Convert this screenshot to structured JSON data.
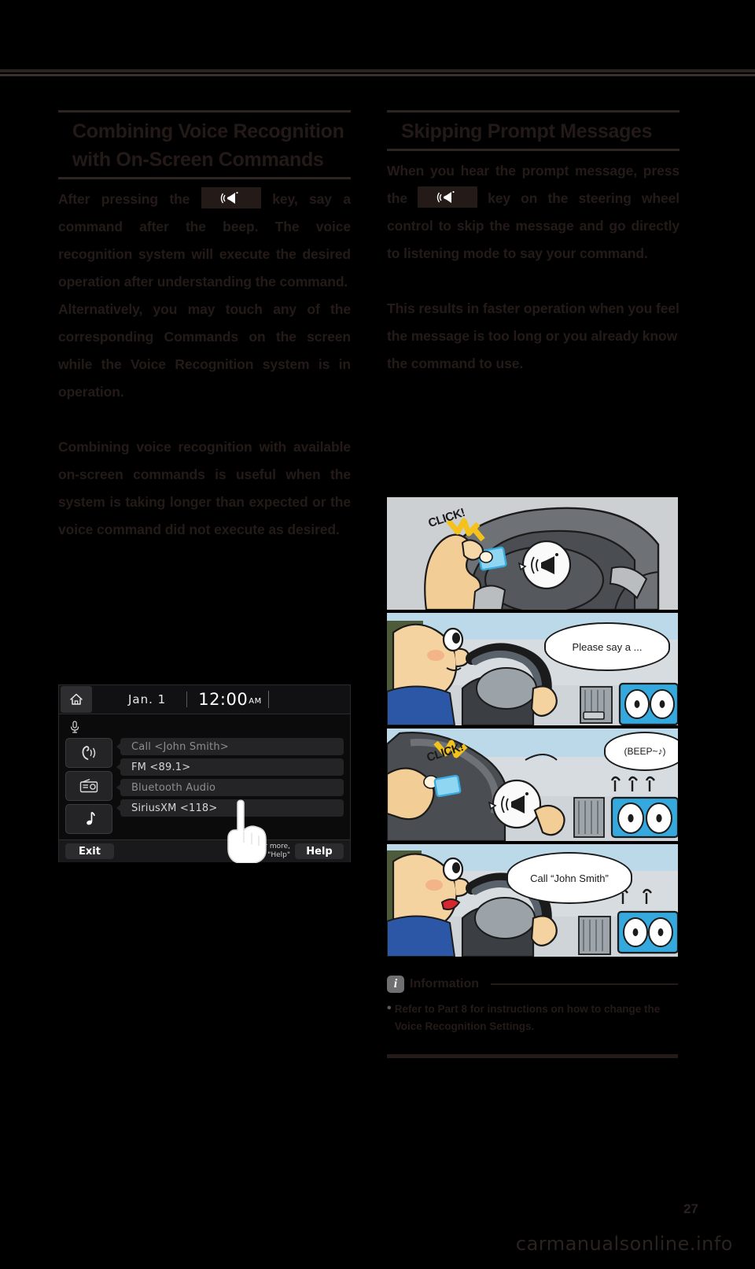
{
  "left_column": {
    "heading": "Combining Voice Recognition with On-Screen Commands",
    "paragraph1_before_key": "After pressing the",
    "paragraph1_after_key": "key, say a command after the beep. The voice recognition system will execute the desired operation after understanding the command.",
    "paragraph2": "Alternatively, you may touch any of the corresponding Commands on the screen while the Voice Recognition system is in operation.",
    "paragraph3": "Combining voice recognition with available on-screen commands is useful when the system is taking longer than expected or the voice command did not execute as desired."
  },
  "right_column": {
    "heading": "Skipping Prompt Messages",
    "paragraph1_before_key": "When you hear the prompt message, press the",
    "paragraph1_after_key": "key on the steering wheel control to skip the message and go directly to listening mode to say your command.",
    "paragraph2": "This results in faster operation when you feel the message is too long or you already know the command to use."
  },
  "screen": {
    "home_icon": "home-icon",
    "date": "Jan. 1",
    "time": "12:00",
    "ampm": "AM",
    "mic_icon": "microphone-icon",
    "tiles": [
      {
        "icon": "phone-call-icon"
      },
      {
        "icon": "radio-icon"
      },
      {
        "icon": "music-note-icon"
      }
    ],
    "commands": [
      {
        "label": "Call <John Smith>",
        "dim": true
      },
      {
        "label": "FM <89.1>",
        "dim": false
      },
      {
        "label": "Bluetooth Audio",
        "dim": true
      },
      {
        "label": "SiriusXM <118>",
        "dim": false
      }
    ],
    "exit_label": "Exit",
    "help_label": "Help",
    "hint_line1": "For more,",
    "hint_line2": "say \"Help\"",
    "hand_icon": "pointing-hand-cursor"
  },
  "comic": {
    "panels": [
      {
        "name": "panel-click-steering-wheel",
        "sound": "CLICK!",
        "bubble": "",
        "bubble_icon": "voice-recognition-icon"
      },
      {
        "name": "panel-please-say-a",
        "sound": "",
        "bubble": "Please say a ...",
        "bubble_icon": ""
      },
      {
        "name": "panel-click-beep",
        "sound": "CLICK!",
        "bubble": "(BEEP~♪)",
        "bubble_icon": "voice-recognition-icon"
      },
      {
        "name": "panel-call-john-smith",
        "sound": "",
        "bubble": "Call “John Smith”",
        "bubble_icon": ""
      }
    ]
  },
  "information": {
    "icon": "info-icon",
    "title": "Information",
    "bullet": "•",
    "text": "Refer to Part 8 for instructions on how to change the Voice Recognition Settings."
  },
  "footer": {
    "page_number": "27",
    "watermark": "carmanualsonline.info"
  },
  "colors": {
    "ink": "#241b18",
    "paper": "#000000",
    "screen_bg": "#0b0b0c",
    "accent_blue": "#35a8dd"
  }
}
